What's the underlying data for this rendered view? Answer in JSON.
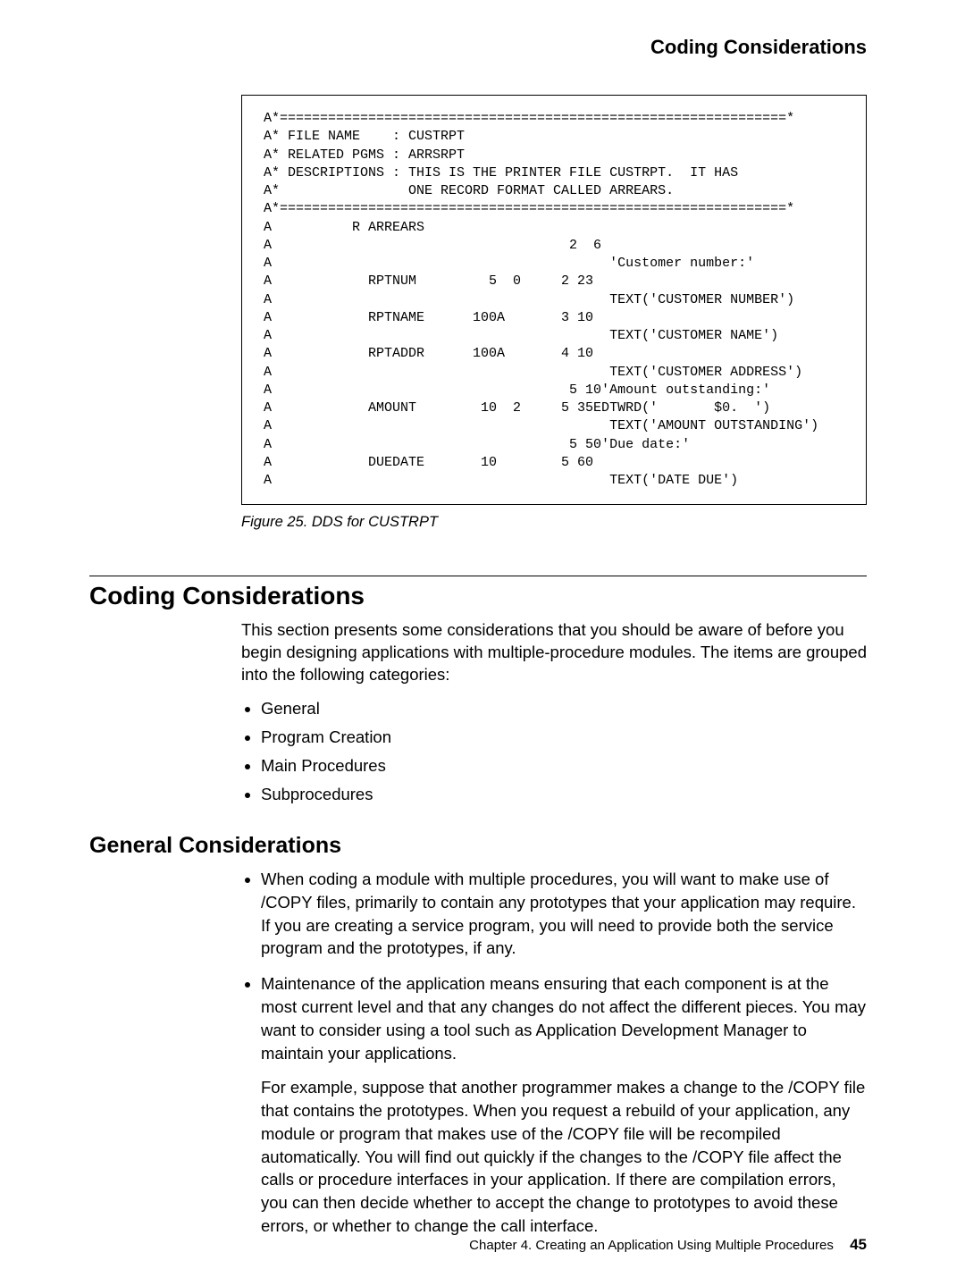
{
  "running_head": "Coding Considerations",
  "code_block": "A*===============================================================*\nA* FILE NAME    : CUSTRPT\nA* RELATED PGMS : ARRSRPT\nA* DESCRIPTIONS : THIS IS THE PRINTER FILE CUSTRPT.  IT HAS\nA*                ONE RECORD FORMAT CALLED ARREARS.\nA*===============================================================*\nA          R ARREARS\nA                                     2  6\nA                                          'Customer number:'\nA            RPTNUM         5  0     2 23\nA                                          TEXT('CUSTOMER NUMBER')\nA            RPTNAME      100A       3 10\nA                                          TEXT('CUSTOMER NAME')\nA            RPTADDR      100A       4 10\nA                                          TEXT('CUSTOMER ADDRESS')\nA                                     5 10'Amount outstanding:'\nA            AMOUNT        10  2     5 35EDTWRD('       $0.  ')\nA                                          TEXT('AMOUNT OUTSTANDING')\nA                                     5 50'Due date:'\nA            DUEDATE       10        5 60\nA                                          TEXT('DATE DUE')",
  "figure_caption": "Figure 25. DDS for CUSTRPT",
  "section_heading": "Coding Considerations",
  "intro_para": "This section presents some considerations that you should be aware of before you begin designing applications with multiple-procedure modules. The items are grouped into the following categories:",
  "intro_bullets": [
    "General",
    "Program Creation",
    "Main Procedures",
    "Subprocedures"
  ],
  "subheading": "General Considerations",
  "gen_bullet1": "When coding a module with multiple procedures, you will want to make use of /COPY files, primarily to contain any prototypes that your application may require. If you are creating a service program, you will need to provide both the service program and the prototypes, if any.",
  "gen_bullet2": "Maintenance of the application means ensuring that each component is at the most current level and that any changes do not affect the different pieces. You may want to consider using a tool such as Application Development Manager to maintain your applications.",
  "gen_bullet2_para": "For example, suppose that another programmer makes a change to the /COPY file that contains the prototypes. When you request a rebuild of your application, any module or program that makes use of the /COPY file will be recompiled automatically. You will find out quickly if the changes to the /COPY file affect the calls or procedure interfaces in your application. If there are compilation errors, you can then decide whether to accept the change to prototypes to avoid these errors, or whether to change the call interface.",
  "footer_chapter": "Chapter 4.  Creating an Application Using Multiple Procedures",
  "footer_page": "45"
}
